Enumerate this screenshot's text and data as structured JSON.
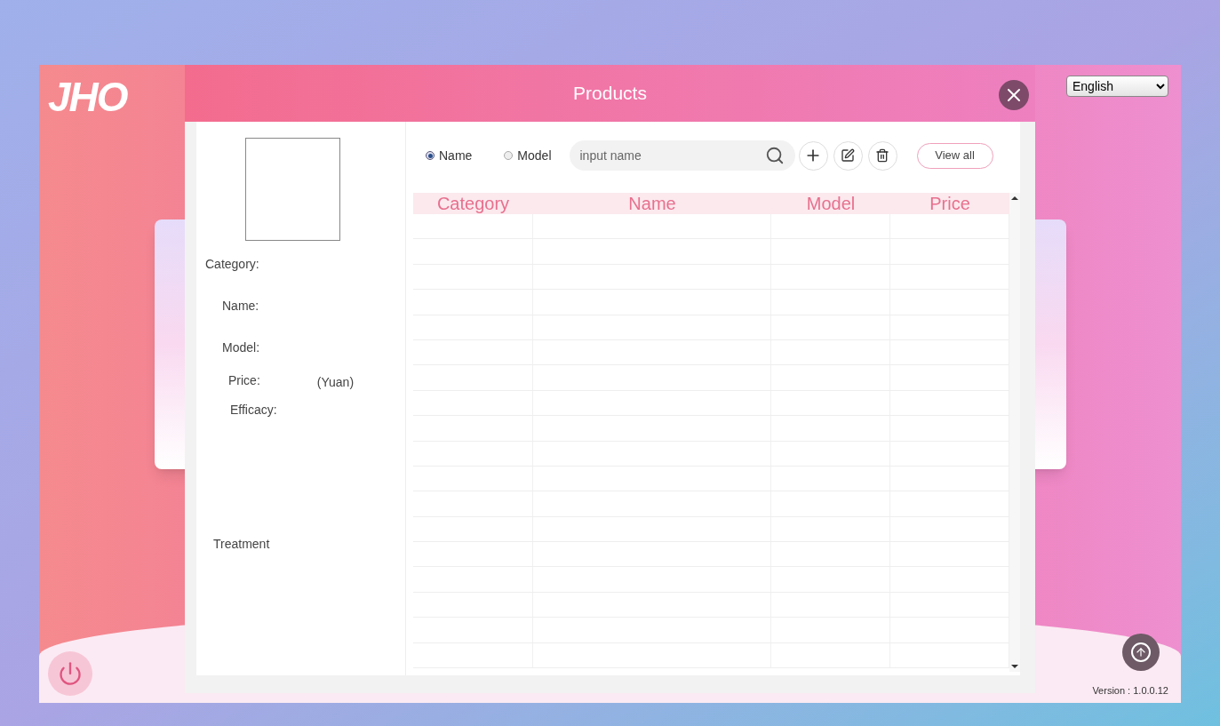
{
  "logo": "JHO",
  "dialog": {
    "title": "Products"
  },
  "language_select": {
    "value": "English"
  },
  "details": {
    "labels": [
      {
        "text": "Category:",
        "kind": "label"
      },
      {
        "text": "Name:",
        "kind": "label"
      },
      {
        "text": "Model:",
        "kind": "label"
      },
      {
        "text": "Price:",
        "kind": "price",
        "unit": "(Yuan)"
      },
      {
        "text": "Efficacy:",
        "kind": "label"
      },
      {
        "text": "Treatment",
        "kind": "tall"
      }
    ]
  },
  "search": {
    "modes": [
      {
        "label": "Name",
        "selected": true
      },
      {
        "label": "Model",
        "selected": false
      }
    ],
    "placeholder": "input name",
    "view_all": "View all"
  },
  "table": {
    "columns": [
      "Category",
      "Name",
      "Model",
      "Price"
    ]
  },
  "version": "Version : 1.0.0.12"
}
